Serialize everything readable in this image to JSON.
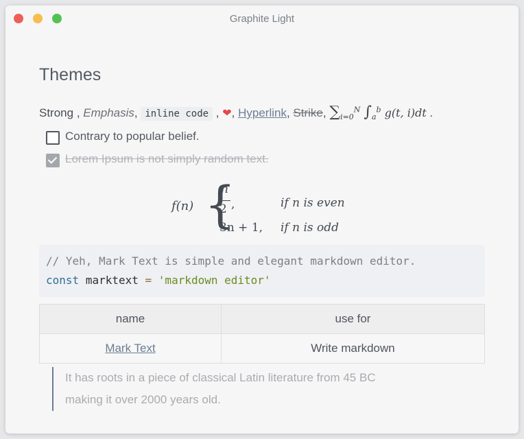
{
  "window": {
    "title": "Graphite Light"
  },
  "doc": {
    "title": "Themes",
    "inline": {
      "strong": "Strong",
      "sep1": " , ",
      "emphasis": "Emphasis",
      "sep2": ", ",
      "code": "inline code",
      "sep3": " , ",
      "heart": "❤",
      "sep4": ", ",
      "hyperlink": "Hyperlink",
      "sep5": ", ",
      "strike": "Strike",
      "sep6": ", ",
      "math": {
        "sum_sup": "N",
        "sum_sub": "i=0",
        "int_sup": "b",
        "int_sub": "a",
        "body": "g(t, i)dt",
        "tail": " ."
      }
    },
    "tasks": [
      {
        "label": "Contrary to popular belief.",
        "checked": false
      },
      {
        "label": "Lorem Ipsum is not simply random text.",
        "checked": true
      }
    ],
    "math_block": {
      "fn": "f(n)",
      "numerator": "n",
      "denominator": "2",
      "comma": ",",
      "cond1": "if n is even",
      "case2": "3n + 1,",
      "cond2": "if n is odd"
    },
    "code_block": {
      "comment": "// Yeh, Mark Text is simple and elegant markdown editor.",
      "keyword": "const",
      "ident": "marktext",
      "op": "=",
      "string": "'markdown editor'"
    },
    "table": {
      "headers": [
        "name",
        "use for"
      ],
      "rows": [
        [
          "Mark Text",
          "Write markdown"
        ]
      ]
    },
    "quote": [
      "It has roots in a piece of classical Latin literature from 45 BC",
      "making it over 2000 years old."
    ]
  },
  "colors": {
    "accent_link": "#6b7d93",
    "heart": "#e2484b",
    "code_string": "#6c8a22",
    "code_keyword": "#2f6f95"
  }
}
